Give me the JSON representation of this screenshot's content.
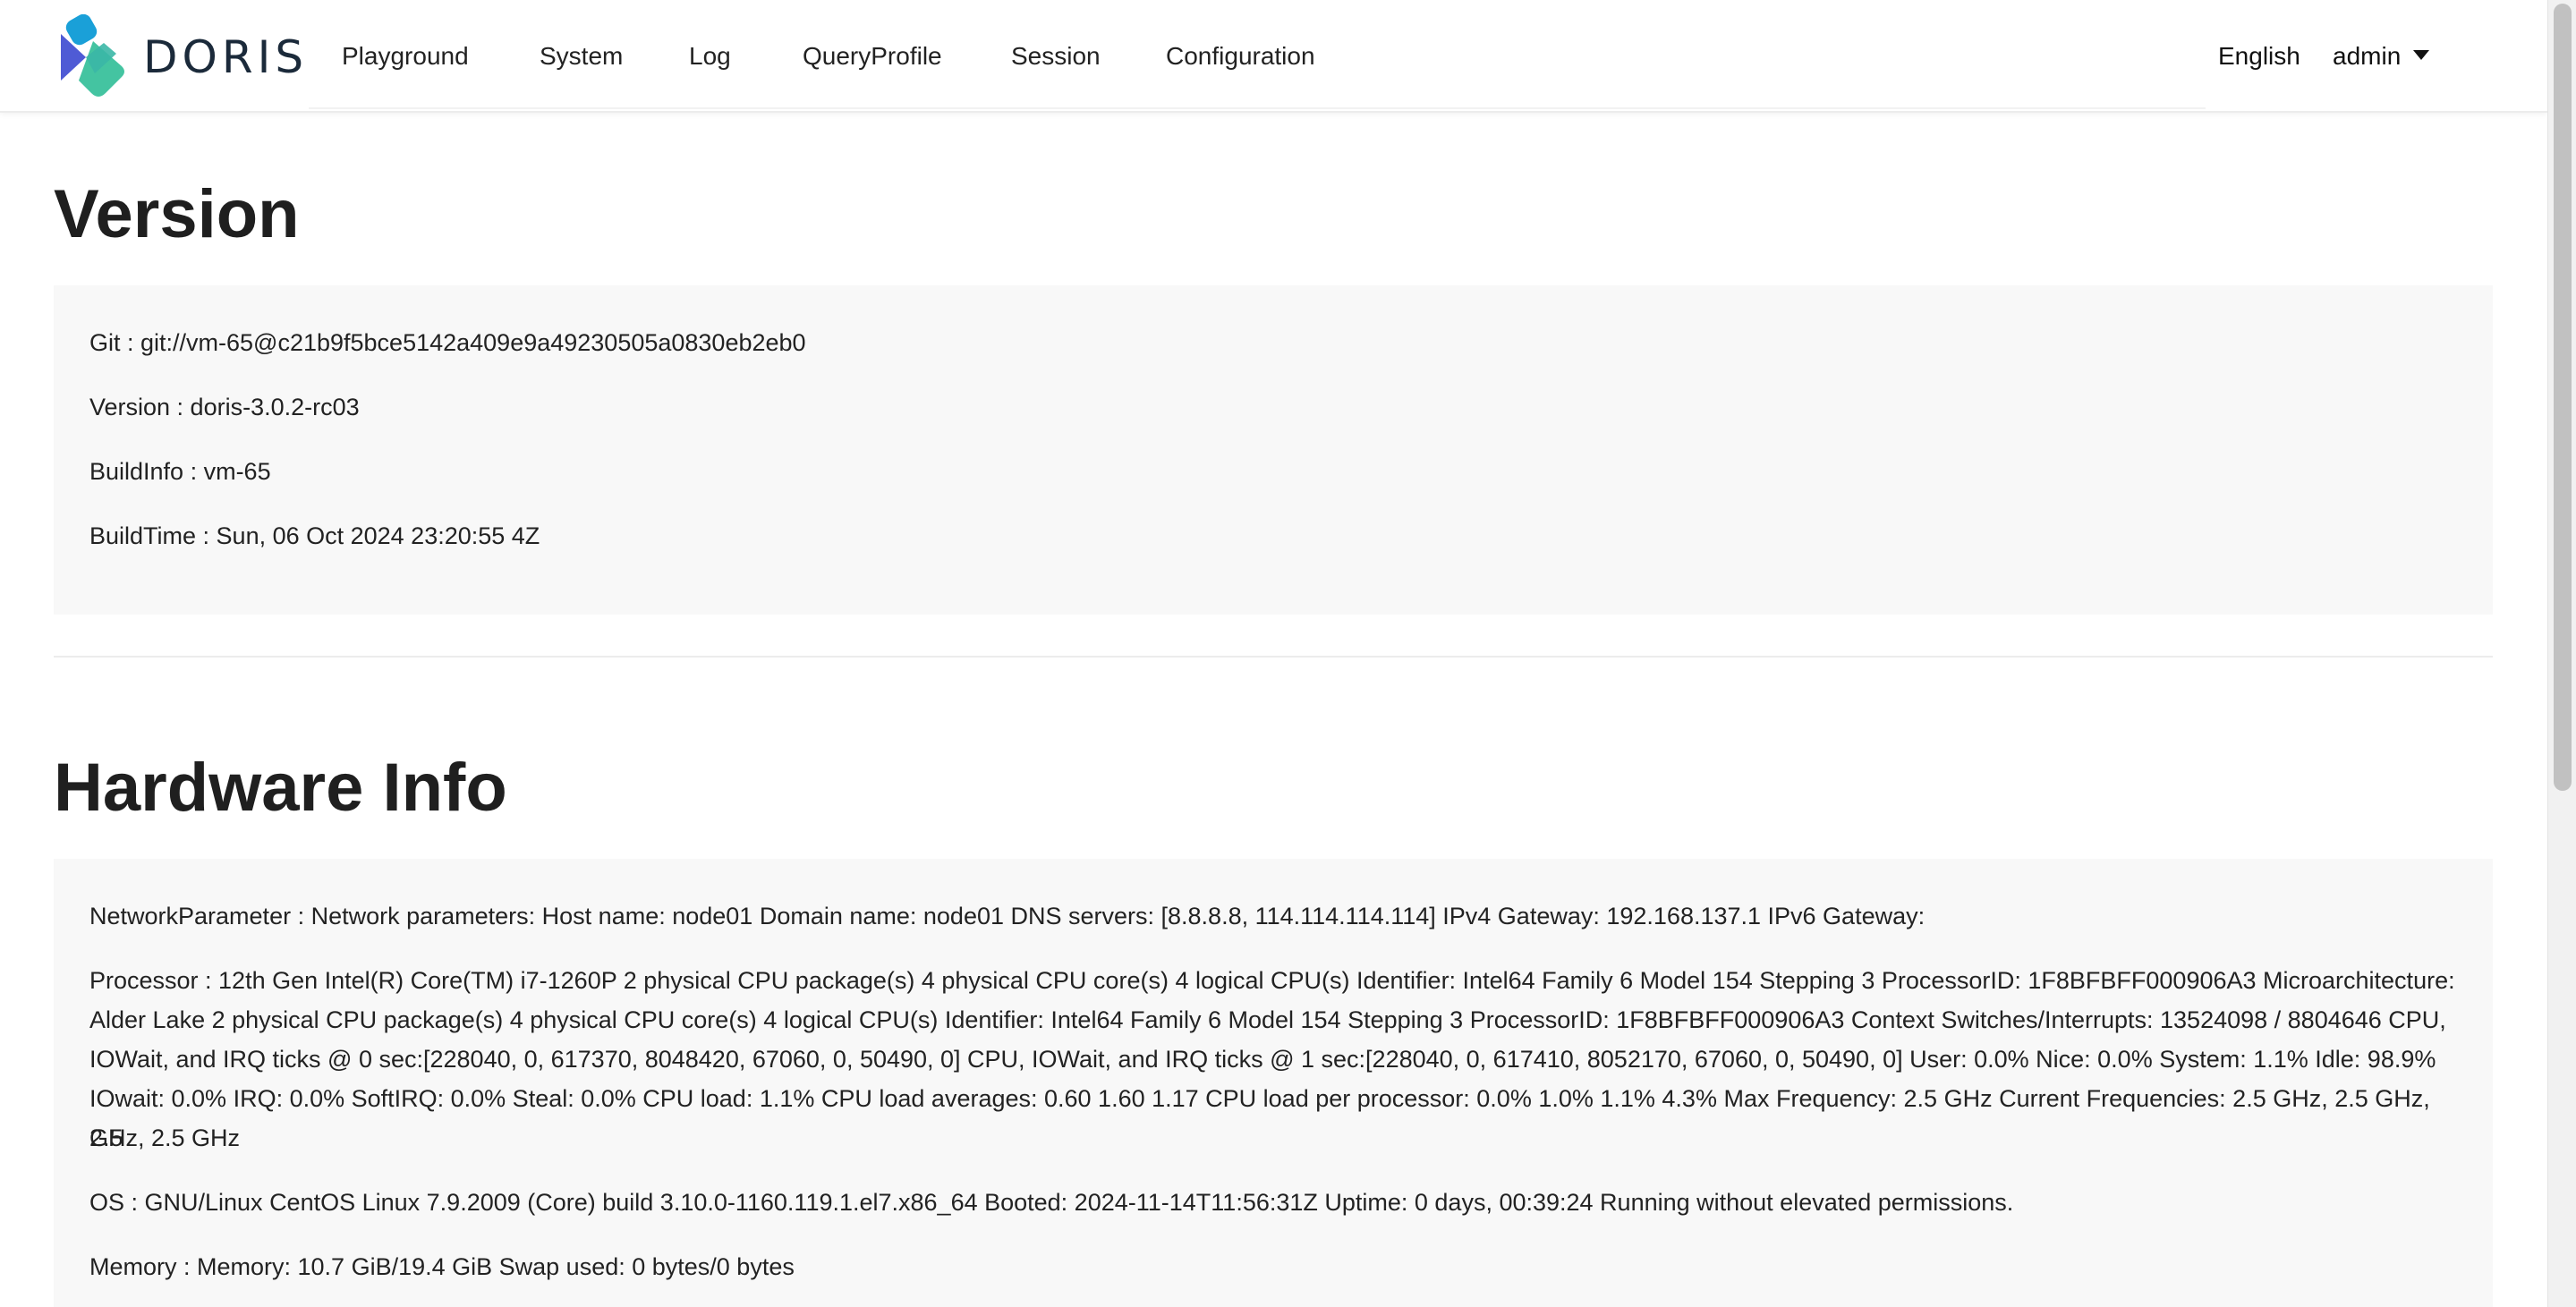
{
  "header": {
    "logo_text": "DORIS",
    "nav": [
      {
        "label": "Playground"
      },
      {
        "label": "System"
      },
      {
        "label": "Log"
      },
      {
        "label": "QueryProfile"
      },
      {
        "label": "Session"
      },
      {
        "label": "Configuration"
      }
    ],
    "language": "English",
    "user": "admin"
  },
  "version": {
    "title": "Version",
    "lines": [
      "Git : git://vm-65@c21b9f5bce5142a409e9a49230505a0830eb2eb0",
      "Version : doris-3.0.2-rc03",
      "BuildInfo : vm-65",
      "BuildTime : Sun, 06 Oct 2024 23:20:55 4Z"
    ]
  },
  "hardware": {
    "title": "Hardware Info",
    "network": "NetworkParameter : Network parameters: Host name: node01 Domain name: node01 DNS servers: [8.8.8.8, 114.114.114.114] IPv4 Gateway: 192.168.137.1 IPv6 Gateway:",
    "processor_lines": [
      "Processor : 12th Gen Intel(R) Core(TM) i7-1260P 2 physical CPU package(s) 4 physical CPU core(s) 4 logical CPU(s) Identifier: Intel64 Family 6 Model 154 Stepping 3 ProcessorID: 1F8BFBFF000906A3 Microarchitecture:",
      "Alder Lake 2 physical CPU package(s) 4 physical CPU core(s) 4 logical CPU(s) Identifier: Intel64 Family 6 Model 154 Stepping 3 ProcessorID: 1F8BFBFF000906A3 Context Switches/Interrupts: 13524098 / 8804646 CPU,",
      "IOWait, and IRQ ticks @ 0 sec:[228040, 0, 617370, 8048420, 67060, 0, 50490, 0] CPU, IOWait, and IRQ ticks @ 1 sec:[228040, 0, 617410, 8052170, 67060, 0, 50490, 0] User: 0.0% Nice: 0.0% System: 1.1% Idle: 98.9%",
      "IOwait: 0.0% IRQ: 0.0% SoftIRQ: 0.0% Steal: 0.0% CPU load: 1.1% CPU load averages: 0.60 1.60 1.17 CPU load per processor: 0.0% 1.0% 1.1% 4.3% Max Frequency: 2.5 GHz Current Frequencies: 2.5 GHz, 2.5 GHz, 2.5",
      "GHz, 2.5 GHz"
    ],
    "os": "OS : GNU/Linux CentOS Linux 7.9.2009 (Core) build 3.10.0-1160.119.1.el7.x86_64 Booted: 2024-11-14T11:56:31Z Uptime: 0 days, 00:39:24 Running without elevated permissions.",
    "memory": "Memory : Memory: 10.7 GiB/19.4 GiB Swap used: 0 bytes/0 bytes"
  },
  "colors": {
    "logo_blue": "#1aa0d8",
    "logo_indigo": "#4f5bd5",
    "logo_green": "#44c4a1",
    "panel_bg": "#f8f8f8",
    "text": "#222222"
  }
}
